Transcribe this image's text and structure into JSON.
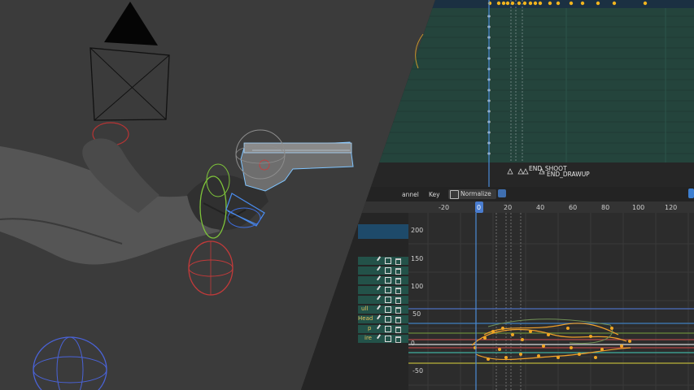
{
  "timeline": {
    "markers": [
      "END_SHOOT",
      "END_DRAWUP"
    ]
  },
  "graph_header": {
    "channel_label": "annel",
    "key_label": "Key",
    "normalize_label": "Normalize"
  },
  "graph": {
    "x_ticks": [
      "-20",
      "0",
      "20",
      "40",
      "60",
      "80",
      "100",
      "120"
    ],
    "current_frame": "0",
    "y_ticks": [
      "200",
      "150",
      "100",
      "50",
      "0",
      "-50"
    ]
  },
  "channels": [
    {
      "label": ""
    },
    {
      "label": ""
    },
    {
      "label": ""
    },
    {
      "label": ""
    },
    {
      "label": ""
    },
    {
      "label": "ull"
    },
    {
      "label": "Head"
    },
    {
      "label": "p"
    },
    {
      "label": "ire"
    }
  ],
  "colors": {
    "viewport_bg": "#3a3a3a",
    "dopesheet_bg": "#24463f",
    "graph_bg": "#2e2e2e",
    "keyframe": "#f0a623",
    "playhead": "#4b8bd6",
    "rig_blue": "#4fb0ff",
    "rig_green": "#8fd13a",
    "rig_red": "#c63a3a"
  }
}
